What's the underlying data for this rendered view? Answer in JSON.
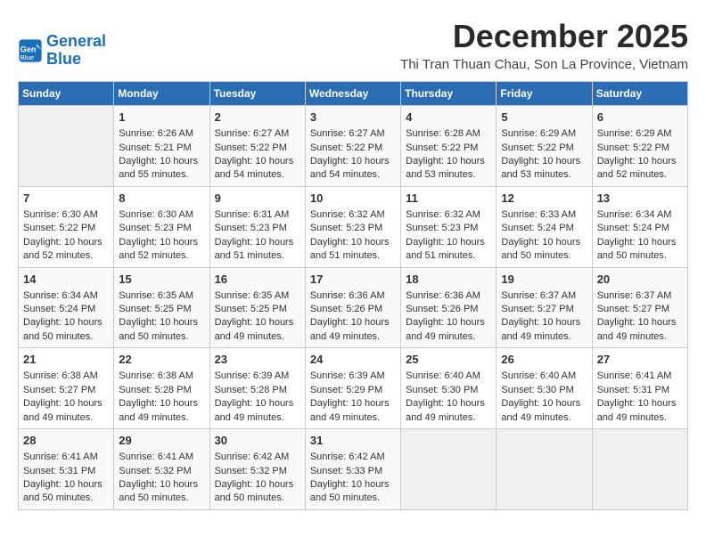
{
  "header": {
    "logo_line1": "General",
    "logo_line2": "Blue",
    "month_year": "December 2025",
    "location": "Thi Tran Thuan Chau, Son La Province, Vietnam"
  },
  "weekdays": [
    "Sunday",
    "Monday",
    "Tuesday",
    "Wednesday",
    "Thursday",
    "Friday",
    "Saturday"
  ],
  "weeks": [
    [
      {
        "day": "",
        "info": ""
      },
      {
        "day": "1",
        "info": "Sunrise: 6:26 AM\nSunset: 5:21 PM\nDaylight: 10 hours\nand 55 minutes."
      },
      {
        "day": "2",
        "info": "Sunrise: 6:27 AM\nSunset: 5:22 PM\nDaylight: 10 hours\nand 54 minutes."
      },
      {
        "day": "3",
        "info": "Sunrise: 6:27 AM\nSunset: 5:22 PM\nDaylight: 10 hours\nand 54 minutes."
      },
      {
        "day": "4",
        "info": "Sunrise: 6:28 AM\nSunset: 5:22 PM\nDaylight: 10 hours\nand 53 minutes."
      },
      {
        "day": "5",
        "info": "Sunrise: 6:29 AM\nSunset: 5:22 PM\nDaylight: 10 hours\nand 53 minutes."
      },
      {
        "day": "6",
        "info": "Sunrise: 6:29 AM\nSunset: 5:22 PM\nDaylight: 10 hours\nand 52 minutes."
      }
    ],
    [
      {
        "day": "7",
        "info": "Sunrise: 6:30 AM\nSunset: 5:22 PM\nDaylight: 10 hours\nand 52 minutes."
      },
      {
        "day": "8",
        "info": "Sunrise: 6:30 AM\nSunset: 5:23 PM\nDaylight: 10 hours\nand 52 minutes."
      },
      {
        "day": "9",
        "info": "Sunrise: 6:31 AM\nSunset: 5:23 PM\nDaylight: 10 hours\nand 51 minutes."
      },
      {
        "day": "10",
        "info": "Sunrise: 6:32 AM\nSunset: 5:23 PM\nDaylight: 10 hours\nand 51 minutes."
      },
      {
        "day": "11",
        "info": "Sunrise: 6:32 AM\nSunset: 5:23 PM\nDaylight: 10 hours\nand 51 minutes."
      },
      {
        "day": "12",
        "info": "Sunrise: 6:33 AM\nSunset: 5:24 PM\nDaylight: 10 hours\nand 50 minutes."
      },
      {
        "day": "13",
        "info": "Sunrise: 6:34 AM\nSunset: 5:24 PM\nDaylight: 10 hours\nand 50 minutes."
      }
    ],
    [
      {
        "day": "14",
        "info": "Sunrise: 6:34 AM\nSunset: 5:24 PM\nDaylight: 10 hours\nand 50 minutes."
      },
      {
        "day": "15",
        "info": "Sunrise: 6:35 AM\nSunset: 5:25 PM\nDaylight: 10 hours\nand 50 minutes."
      },
      {
        "day": "16",
        "info": "Sunrise: 6:35 AM\nSunset: 5:25 PM\nDaylight: 10 hours\nand 49 minutes."
      },
      {
        "day": "17",
        "info": "Sunrise: 6:36 AM\nSunset: 5:26 PM\nDaylight: 10 hours\nand 49 minutes."
      },
      {
        "day": "18",
        "info": "Sunrise: 6:36 AM\nSunset: 5:26 PM\nDaylight: 10 hours\nand 49 minutes."
      },
      {
        "day": "19",
        "info": "Sunrise: 6:37 AM\nSunset: 5:27 PM\nDaylight: 10 hours\nand 49 minutes."
      },
      {
        "day": "20",
        "info": "Sunrise: 6:37 AM\nSunset: 5:27 PM\nDaylight: 10 hours\nand 49 minutes."
      }
    ],
    [
      {
        "day": "21",
        "info": "Sunrise: 6:38 AM\nSunset: 5:27 PM\nDaylight: 10 hours\nand 49 minutes."
      },
      {
        "day": "22",
        "info": "Sunrise: 6:38 AM\nSunset: 5:28 PM\nDaylight: 10 hours\nand 49 minutes."
      },
      {
        "day": "23",
        "info": "Sunrise: 6:39 AM\nSunset: 5:28 PM\nDaylight: 10 hours\nand 49 minutes."
      },
      {
        "day": "24",
        "info": "Sunrise: 6:39 AM\nSunset: 5:29 PM\nDaylight: 10 hours\nand 49 minutes."
      },
      {
        "day": "25",
        "info": "Sunrise: 6:40 AM\nSunset: 5:30 PM\nDaylight: 10 hours\nand 49 minutes."
      },
      {
        "day": "26",
        "info": "Sunrise: 6:40 AM\nSunset: 5:30 PM\nDaylight: 10 hours\nand 49 minutes."
      },
      {
        "day": "27",
        "info": "Sunrise: 6:41 AM\nSunset: 5:31 PM\nDaylight: 10 hours\nand 49 minutes."
      }
    ],
    [
      {
        "day": "28",
        "info": "Sunrise: 6:41 AM\nSunset: 5:31 PM\nDaylight: 10 hours\nand 50 minutes."
      },
      {
        "day": "29",
        "info": "Sunrise: 6:41 AM\nSunset: 5:32 PM\nDaylight: 10 hours\nand 50 minutes."
      },
      {
        "day": "30",
        "info": "Sunrise: 6:42 AM\nSunset: 5:32 PM\nDaylight: 10 hours\nand 50 minutes."
      },
      {
        "day": "31",
        "info": "Sunrise: 6:42 AM\nSunset: 5:33 PM\nDaylight: 10 hours\nand 50 minutes."
      },
      {
        "day": "",
        "info": ""
      },
      {
        "day": "",
        "info": ""
      },
      {
        "day": "",
        "info": ""
      }
    ]
  ]
}
